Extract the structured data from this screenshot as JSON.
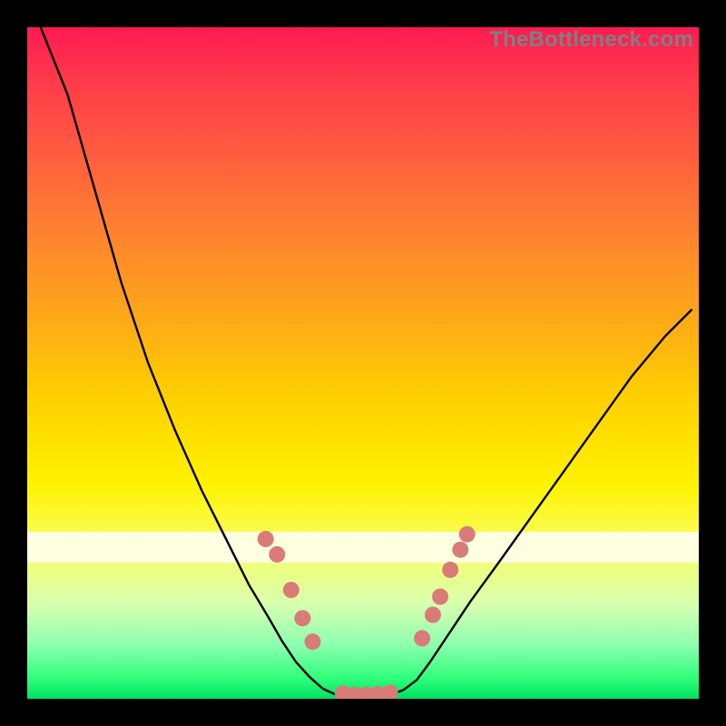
{
  "watermark": "TheBottleneck.com",
  "colors": {
    "frame": "#000000",
    "gradient_top": "#ff1a52",
    "gradient_mid": "#fff200",
    "gradient_bottom": "#00e060",
    "curve": "#000000",
    "marker": "#d97b78",
    "band": "#fcffe0"
  },
  "chart_data": {
    "type": "line",
    "title": "",
    "xlabel": "",
    "ylabel": "",
    "xlim": [
      0,
      100
    ],
    "ylim": [
      0,
      100
    ],
    "grid": false,
    "series": [
      {
        "name": "left-branch",
        "x": [
          2,
          6,
          10,
          14,
          18,
          22,
          26,
          30,
          33,
          36,
          38,
          40,
          42,
          44
        ],
        "y": [
          100,
          90,
          76,
          62,
          50,
          40,
          31,
          23,
          17,
          12,
          8.5,
          5.5,
          3.3,
          1.5
        ]
      },
      {
        "name": "valley-floor",
        "x": [
          44,
          46,
          48,
          50,
          52,
          54,
          56
        ],
        "y": [
          1.5,
          0.6,
          0.3,
          0.2,
          0.3,
          0.6,
          1.3
        ]
      },
      {
        "name": "right-branch",
        "x": [
          56,
          58,
          60,
          63,
          66,
          70,
          75,
          80,
          85,
          90,
          95,
          99
        ],
        "y": [
          1.3,
          2.8,
          5.5,
          10,
          14.5,
          20,
          27,
          34,
          41,
          48,
          54,
          58
        ]
      }
    ],
    "markers": {
      "name": "highlight-points",
      "points": [
        {
          "x": 35.5,
          "y": 23.8
        },
        {
          "x": 37.2,
          "y": 21.5
        },
        {
          "x": 39.3,
          "y": 16.2
        },
        {
          "x": 41.0,
          "y": 12.0
        },
        {
          "x": 42.5,
          "y": 8.5
        },
        {
          "x": 47.0,
          "y": 0.8
        },
        {
          "x": 48.8,
          "y": 0.6
        },
        {
          "x": 50.5,
          "y": 0.6
        },
        {
          "x": 52.2,
          "y": 0.7
        },
        {
          "x": 54.0,
          "y": 0.9
        },
        {
          "x": 58.8,
          "y": 9.0
        },
        {
          "x": 60.4,
          "y": 12.5
        },
        {
          "x": 61.5,
          "y": 15.2
        },
        {
          "x": 63.0,
          "y": 19.2
        },
        {
          "x": 64.5,
          "y": 22.2
        },
        {
          "x": 65.5,
          "y": 24.5
        }
      ]
    }
  }
}
